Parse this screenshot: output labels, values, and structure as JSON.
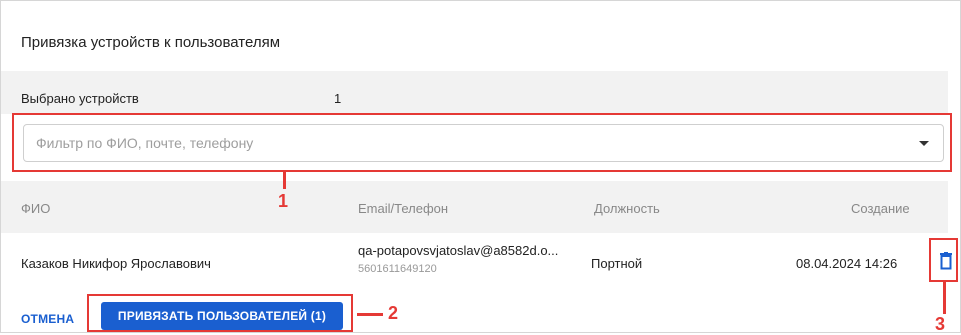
{
  "dialog": {
    "title": "Привязка устройств к пользователям",
    "selected_label": "Выбрано устройств",
    "selected_count": "1"
  },
  "filter": {
    "placeholder": "Фильтр по ФИО, почте, телефону",
    "value": ""
  },
  "table": {
    "columns": [
      "ФИО",
      "Email/Телефон",
      "Должность",
      "Создание"
    ],
    "rows": [
      {
        "fio": "Казаков Никифор Ярославович",
        "email": "qa-potapovsvjatoslav@a8582d.o...",
        "phone": "5601611649120",
        "position": "Портной",
        "created": "08.04.2024 14:26"
      }
    ]
  },
  "actions": {
    "cancel_label": "ОТМЕНА",
    "bind_label": "ПРИВЯЗАТЬ ПОЛЬЗОВАТЕЛЕЙ (1)"
  },
  "annotations": {
    "n1": "1",
    "n2": "2",
    "n3": "3"
  },
  "colors": {
    "accent": "#1a5fd0",
    "annotation": "#e53935",
    "row_bg": "#f2f2f2"
  },
  "icons": {
    "delete": "trash-icon",
    "dropdown": "chevron-down-icon"
  }
}
